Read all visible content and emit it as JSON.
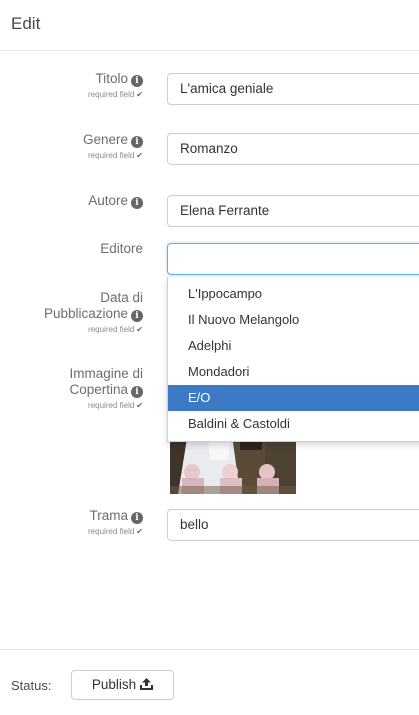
{
  "header": {
    "title": "Edit"
  },
  "form": {
    "required_text": "required field",
    "fields": {
      "titolo": {
        "label": "Titolo",
        "value": "L'amica geniale"
      },
      "genere": {
        "label": "Genere",
        "value": "Romanzo"
      },
      "autore": {
        "label": "Autore",
        "value": "Elena Ferrante"
      },
      "editore": {
        "label": "Editore",
        "value": ""
      },
      "data": {
        "label_line1": "Data di",
        "label_line2": "Pubblicazione"
      },
      "copertina": {
        "label_line1": "Immagine di",
        "label_line2": "Copertina"
      },
      "trama": {
        "label": "Trama",
        "value": "bello"
      }
    }
  },
  "dropdown": {
    "options": [
      "L'Ippocampo",
      "Il Nuovo Melangolo",
      "Adelphi",
      "Mondadori",
      "E/O",
      "Baldini & Castoldi"
    ],
    "highlighted": "E/O"
  },
  "footer": {
    "status_label": "Status:",
    "publish_label": "Publish"
  },
  "icons": {
    "info": "info-circle-icon",
    "check": "check-icon",
    "upload": "upload-icon"
  },
  "colors": {
    "highlight": "#3c7ac5",
    "focus_border": "#66afe9"
  }
}
